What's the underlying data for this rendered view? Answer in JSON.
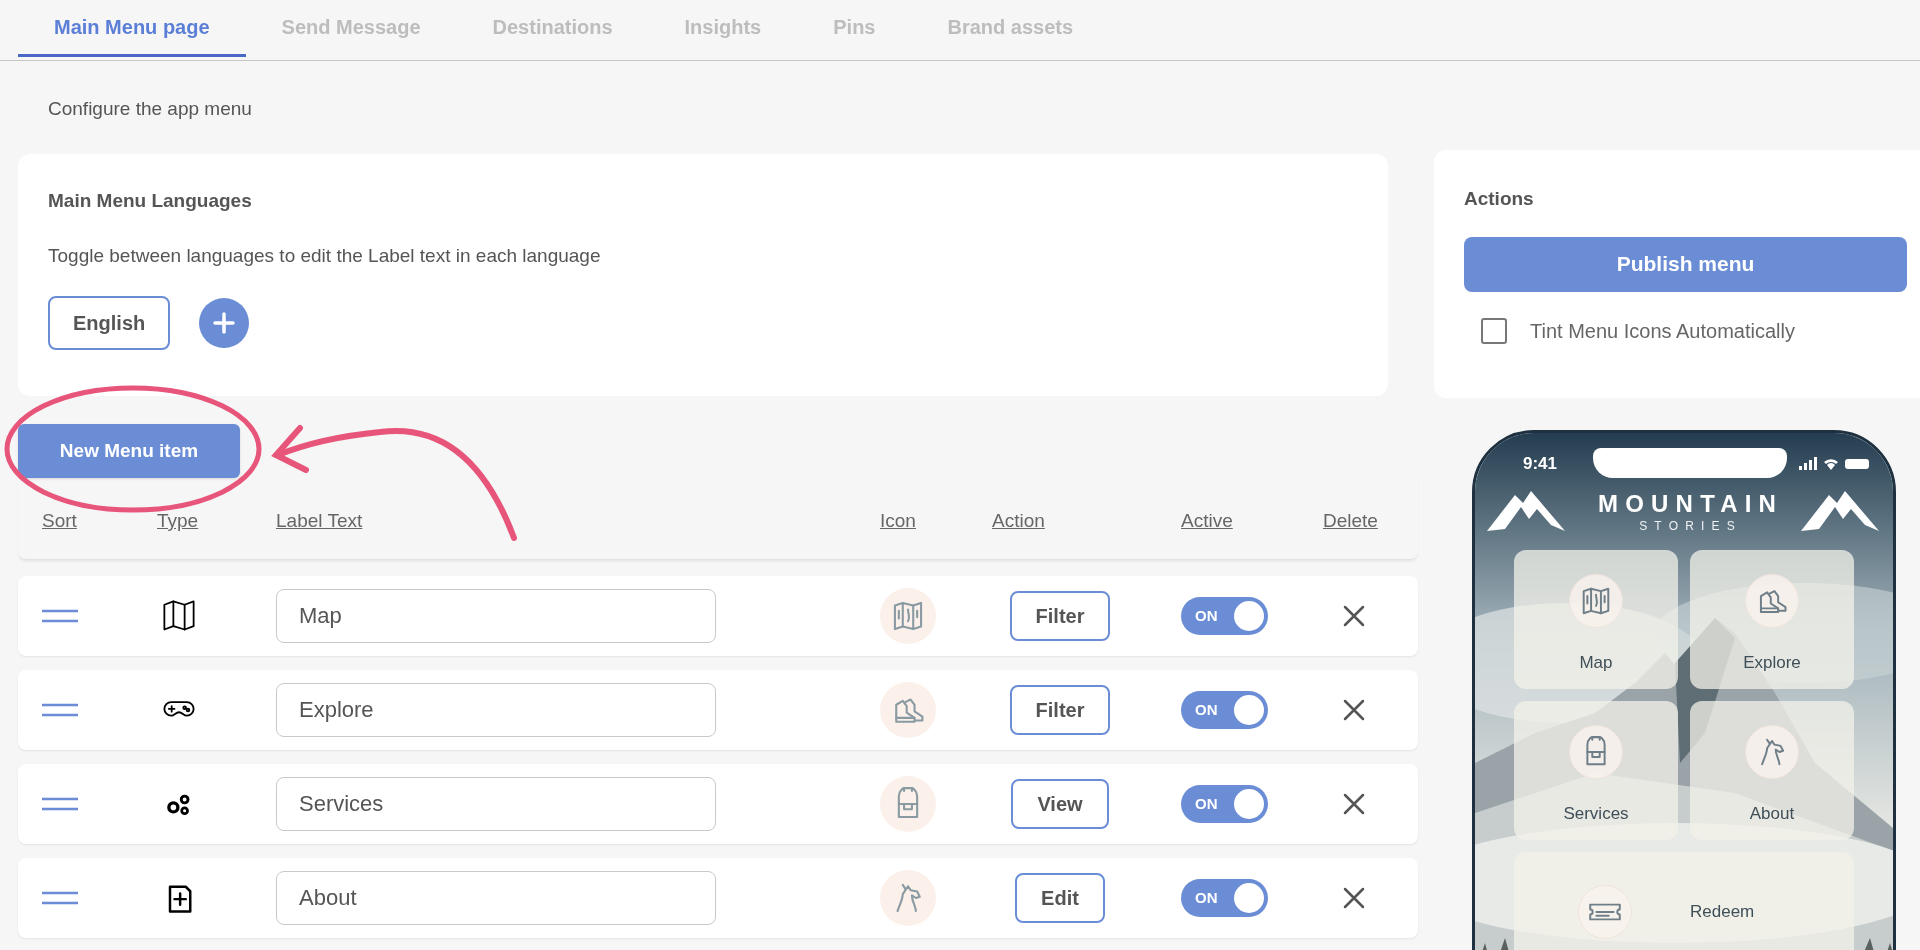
{
  "tabs": [
    {
      "label": "Main Menu page",
      "selected": true
    },
    {
      "label": "Send Message",
      "selected": false
    },
    {
      "label": "Destinations",
      "selected": false
    },
    {
      "label": "Insights",
      "selected": false
    },
    {
      "label": "Pins",
      "selected": false
    },
    {
      "label": "Brand assets",
      "selected": false
    }
  ],
  "page_description": "Configure the app menu",
  "languages_card": {
    "title": "Main Menu Languages",
    "description": "Toggle between languages to edit the Label text in each language",
    "languages": [
      {
        "label": "English",
        "selected": true
      }
    ]
  },
  "new_item_button": "New Menu item",
  "columns": [
    "Sort",
    "Type",
    "Label Text",
    "Icon",
    "Action",
    "Active",
    "Delete"
  ],
  "rows": [
    {
      "label": "Map",
      "action": "Filter",
      "active": true,
      "toggle_label": "ON"
    },
    {
      "label": "Explore",
      "action": "Filter",
      "active": true,
      "toggle_label": "ON"
    },
    {
      "label": "Services",
      "action": "View",
      "active": true,
      "toggle_label": "ON"
    },
    {
      "label": "About",
      "action": "Edit",
      "active": true,
      "toggle_label": "ON"
    }
  ],
  "actions_card": {
    "title": "Actions",
    "publish_button": "Publish menu",
    "tint_checkbox": {
      "label": "Tint Menu Icons Automatically",
      "checked": false
    }
  },
  "phone_preview": {
    "time": "9:41",
    "brand_title": "MOUNTAIN",
    "brand_subtitle": "STORIES",
    "tiles": [
      {
        "label": "Map"
      },
      {
        "label": "Explore"
      },
      {
        "label": "Services"
      },
      {
        "label": "About"
      },
      {
        "label": "Redeem"
      }
    ]
  }
}
